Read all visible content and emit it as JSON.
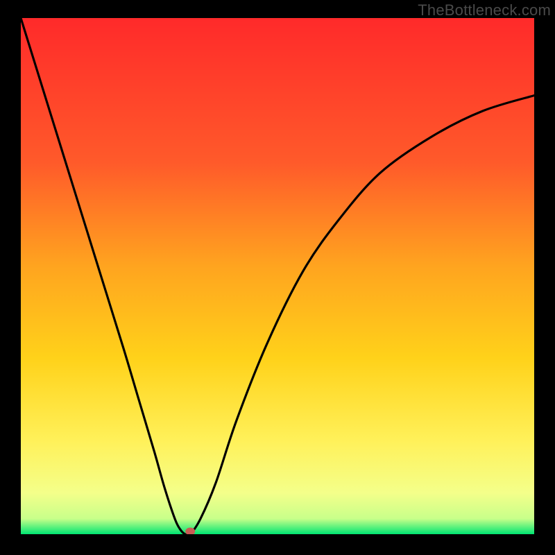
{
  "watermark": "TheBottleneck.com",
  "colors": {
    "frame": "#000000",
    "watermark": "#4a4a4a",
    "gradient_top": "#ff2a2a",
    "gradient_mid_upper": "#ff8a2a",
    "gradient_mid": "#ffd52a",
    "gradient_mid_lower": "#fff47a",
    "gradient_lower": "#f2ff9a",
    "gradient_bottom": "#00e572",
    "curve": "#000000",
    "marker": "#c95b54"
  },
  "chart_data": {
    "type": "line",
    "title": "",
    "xlabel": "",
    "ylabel": "",
    "xlim": [
      0,
      100
    ],
    "ylim": [
      0,
      100
    ],
    "series": [
      {
        "name": "bottleneck-curve",
        "x": [
          0,
          5,
          10,
          15,
          20,
          23,
          26,
          28,
          30,
          31,
          32,
          33,
          35,
          38,
          42,
          48,
          55,
          62,
          70,
          80,
          90,
          100
        ],
        "y": [
          100,
          84,
          68,
          52,
          36,
          26,
          16,
          9,
          3,
          1,
          0,
          0,
          3,
          10,
          22,
          37,
          51,
          61,
          70,
          77,
          82,
          85
        ]
      }
    ],
    "markers": [
      {
        "name": "optimal-point",
        "x": 33,
        "y": 0
      }
    ]
  }
}
